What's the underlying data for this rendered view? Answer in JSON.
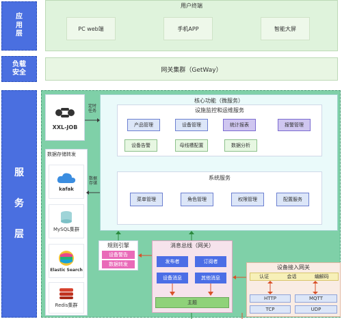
{
  "layers": {
    "app": "应\n用\n层",
    "lb": "负载\n安全",
    "service": "服\n务\n层"
  },
  "user_terminal": {
    "title": "用户终端",
    "items": [
      "PC web端",
      "手机APP",
      "智能大屏"
    ]
  },
  "gateway": {
    "label": "网关集群（GetWay）"
  },
  "core": {
    "title": "核心功能（微服务）",
    "monitor": {
      "title": "设施监控和运维服务",
      "row1": [
        "产品管理",
        "设备管理",
        "统计报表",
        "报警管理"
      ],
      "row2": [
        "设备告警",
        "母线槽配置",
        "数据分析"
      ]
    },
    "system": {
      "title": "系统服务",
      "items": [
        "菜单管理",
        "角色管理",
        "权限管理",
        "配置服务"
      ]
    }
  },
  "xxl_job": {
    "label": "XXL-JOB",
    "arrow_label": "定时\n任务"
  },
  "storage": {
    "title": "数据存储转发",
    "arrow_label": "数据\n存储",
    "items": [
      "kafak",
      "MySQL集群",
      "Elastic Search",
      "Redis集群"
    ]
  },
  "rule_engine": {
    "title": "规则引擎",
    "items": [
      "设备警告",
      "数据转发"
    ]
  },
  "message_bus": {
    "title": "消息总线（网关）",
    "items": [
      "发布者",
      "订阅者",
      "设备消息",
      "其他消息"
    ],
    "topic": "主题"
  },
  "device_gateway": {
    "title": "设备接入网关",
    "auth": [
      "认证",
      "会话",
      "编解码"
    ],
    "protocols": [
      "HTTP",
      "MQTT",
      "TCP",
      "UDP"
    ]
  },
  "colors": {
    "layer_blue": "#4a6fe0",
    "panel_green": "#dff3dc",
    "service_green": "#7fd0a8",
    "core_panel": "#eafafa"
  }
}
